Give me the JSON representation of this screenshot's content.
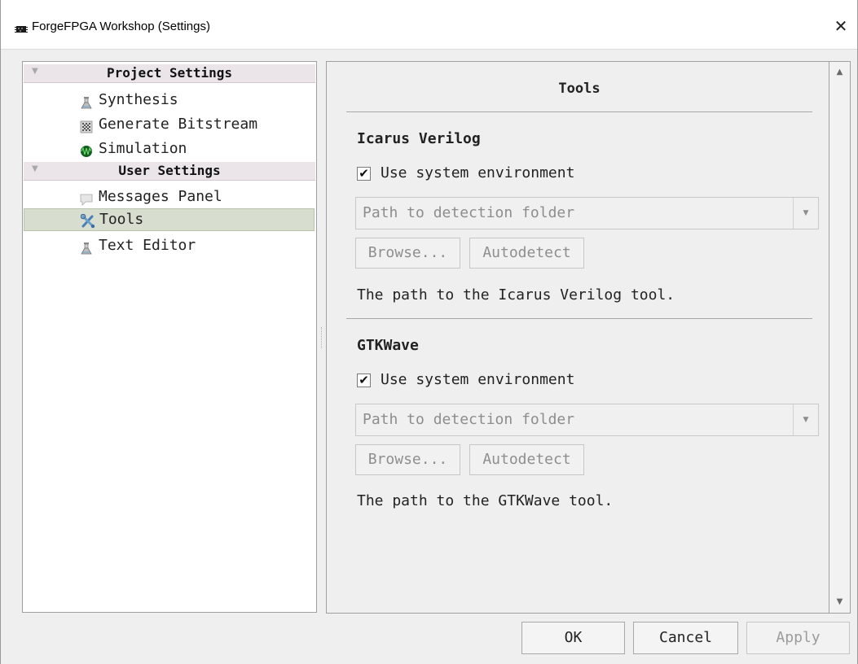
{
  "window": {
    "title": "ForgeFPGA Workshop (Settings)",
    "close_label": "✕"
  },
  "tree": {
    "groups": [
      {
        "label": "Project Settings",
        "expanded": true,
        "items": [
          {
            "label": "Synthesis",
            "icon": "flask-icon"
          },
          {
            "label": "Generate Bitstream",
            "icon": "bitstream-icon"
          },
          {
            "label": "Simulation",
            "icon": "waveform-icon"
          }
        ]
      },
      {
        "label": "User Settings",
        "expanded": true,
        "items": [
          {
            "label": "Messages Panel",
            "icon": "speech-bubble-icon"
          },
          {
            "label": "Tools",
            "icon": "tools-icon",
            "selected": true
          },
          {
            "label": "Text Editor",
            "icon": "flask-icon"
          }
        ]
      }
    ]
  },
  "page": {
    "title": "Tools",
    "sections": [
      {
        "title": "Icarus Verilog",
        "use_system_env_label": "Use system environment",
        "use_system_env_checked": true,
        "path_placeholder": "Path to detection folder",
        "browse_label": "Browse...",
        "autodetect_label": "Autodetect",
        "description": "The path to the Icarus Verilog tool."
      },
      {
        "title": "GTKWave",
        "use_system_env_label": "Use system environment",
        "use_system_env_checked": true,
        "path_placeholder": "Path to detection folder",
        "browse_label": "Browse...",
        "autodetect_label": "Autodetect",
        "description": "The path to the GTKWave tool."
      }
    ]
  },
  "footer": {
    "ok_label": "OK",
    "cancel_label": "Cancel",
    "apply_label": "Apply",
    "apply_enabled": false
  }
}
